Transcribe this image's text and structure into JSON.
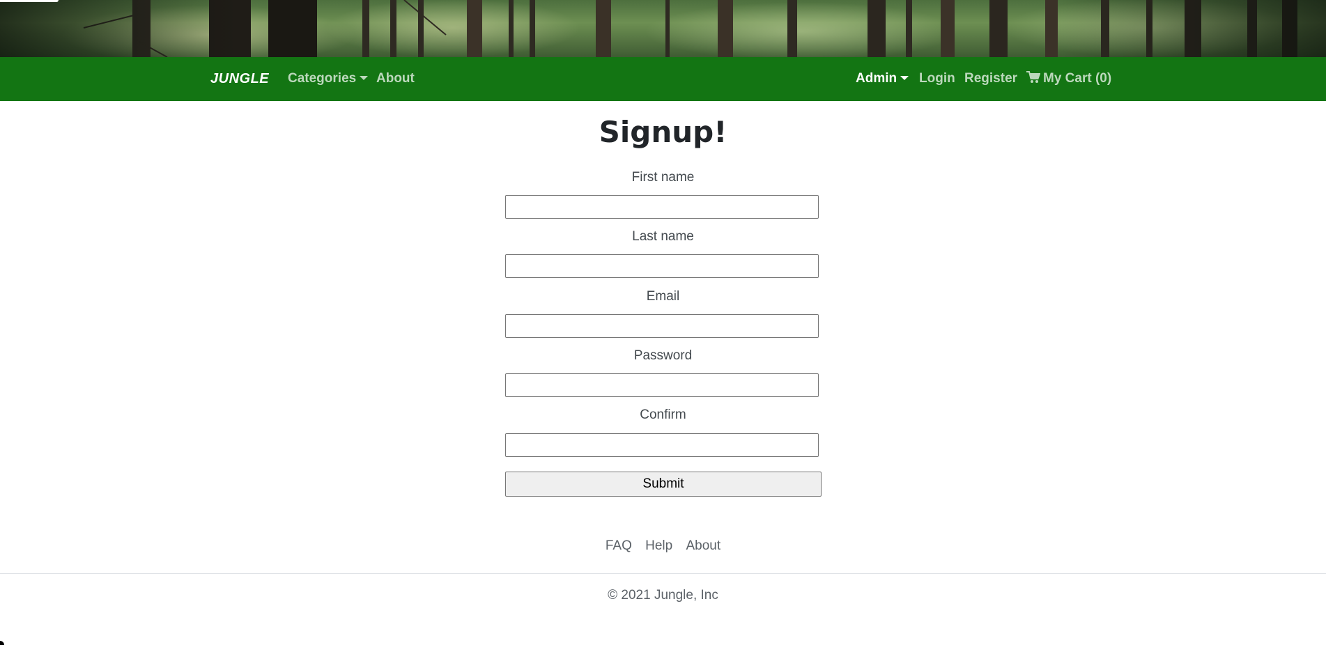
{
  "navbar": {
    "brand": "JUNGLE",
    "categories_label": "Categories",
    "about_label": "About",
    "admin_label": "Admin",
    "login_label": "Login",
    "register_label": "Register",
    "cart_label": "My Cart (0)"
  },
  "form": {
    "title": "Signup!",
    "fields": [
      {
        "label": "First name",
        "value": ""
      },
      {
        "label": "Last name",
        "value": ""
      },
      {
        "label": "Email",
        "value": ""
      },
      {
        "label": "Password",
        "value": ""
      },
      {
        "label": "Confirm",
        "value": ""
      }
    ],
    "submit_label": "Submit"
  },
  "footer": {
    "links": [
      "FAQ",
      "Help",
      "About"
    ],
    "copyright": "© 2021 Jungle, Inc"
  },
  "colors": {
    "navbar_bg": "#137513",
    "nav_link": "#bcd8bc",
    "nav_link_active": "#ffffff"
  },
  "icons": {
    "cart": "shopping-cart-icon",
    "dropdown": "caret-down-icon"
  }
}
